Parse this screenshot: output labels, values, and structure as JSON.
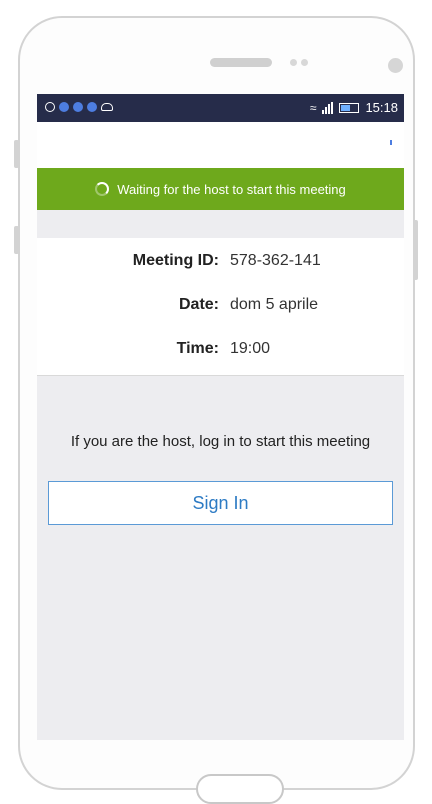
{
  "status_bar": {
    "time": "15:18",
    "icons": [
      "chat-icon",
      "app-icon",
      "app-icon",
      "app-icon",
      "cloud-icon",
      "wifi-icon",
      "signal-icon",
      "battery-icon"
    ]
  },
  "banner": {
    "text": "Waiting for the host to start this meeting",
    "color": "#6ea91c"
  },
  "meeting": {
    "id_label": "Meeting ID:",
    "id_value": "578-362-141",
    "date_label": "Date:",
    "date_value": "dom 5 aprile",
    "time_label": "Time:",
    "time_value": "19:00"
  },
  "host_prompt": "If you are the host, log in to start this meeting",
  "sign_in": {
    "label": "Sign In",
    "color": "#2d7bc4"
  }
}
